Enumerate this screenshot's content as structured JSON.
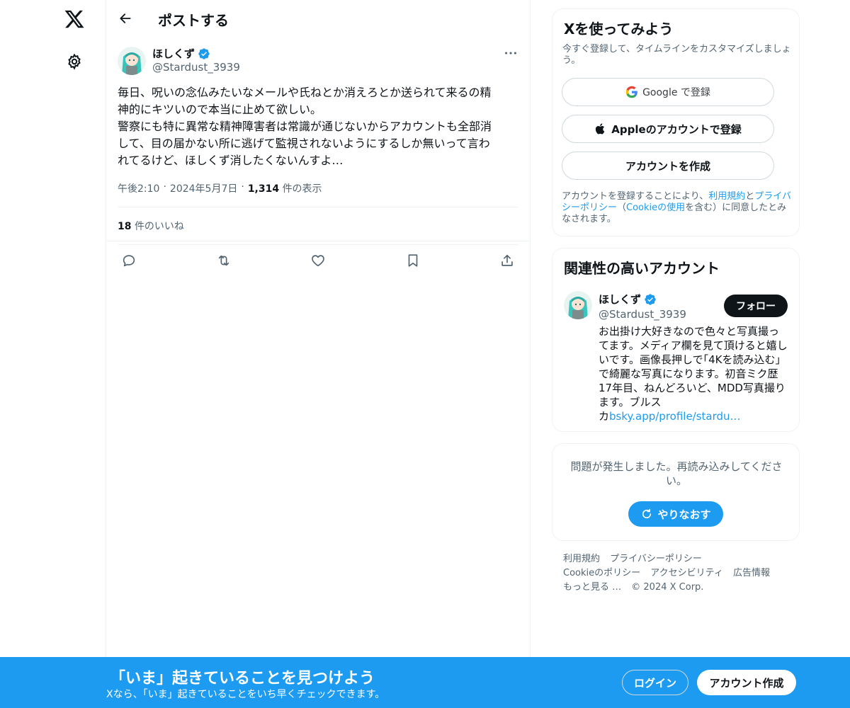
{
  "header": {
    "title": "ポストする"
  },
  "post": {
    "author_name": "ほしくず",
    "author_handle": "@Stardust_3939",
    "text": "毎日、呪いの念仏みたいなメールや氏ねとか消えろとか送られて来るの精\n神的にキツいので本当に止めて欲しい。\n警察にも特に異常な精神障害者は常識が通じないからアカウントも全部消\nして、目の届かない所に逃げて監視されないようにするしか無いって言わ\nれてるけど、ほしくず消したくないんすよ…",
    "time": "午後2:10",
    "date": "2024年5月7日",
    "views_count": "1,314",
    "views_label": "件の表示",
    "likes_count": "18",
    "likes_label": "件のいいね"
  },
  "signup": {
    "title": "Xを使ってみよう",
    "subtitle": "今すぐ登録して、タイムラインをカスタマイズしましょう。",
    "google_label": "Google で登録",
    "apple_label": "Appleのアカウントで登録",
    "create_label": "アカウントを作成",
    "terms_pre": "アカウントを登録することにより、",
    "terms_link": "利用規約",
    "terms_and": "と",
    "privacy_link": "プライバシーポリシー",
    "terms_mid": "（",
    "cookie_link": "Cookieの使用",
    "terms_post": "を含む）に同意したとみなされます。"
  },
  "related": {
    "title": "関連性の高いアカウント",
    "name": "ほしくず",
    "handle": "@Stardust_3939",
    "follow_label": "フォロー",
    "bio": "お出掛け大好きなので色々と写真撮っ\nてます。メディア欄を見て頂けると嬉し\nいです。画像長押しで｢4Kを読み込む｣\nで綺麗な写真になります。初音ミク歴\n17年目、ねんどろいど、MDD写真撮り\nます。ブルス\nカ",
    "bio_link": "bsky.app/profile/stardu…"
  },
  "error": {
    "message": "問題が発生しました。再読み込みしてください。",
    "retry_label": "やりなおす"
  },
  "footer": {
    "terms": "利用規約",
    "privacy": "プライバシーポリシー",
    "cookie": "Cookieのポリシー",
    "accessibility": "アクセシビリティ",
    "ads": "広告情報",
    "more": "もっと見る …",
    "copyright": "© 2024 X Corp."
  },
  "bottombar": {
    "title": "「いま」起きていることを見つけよう",
    "subtitle": "Xなら、「いま」起きていることをいち早くチェックできます。",
    "login_label": "ログイン",
    "signup_label": "アカウント作成"
  },
  "colors": {
    "accent": "#1d9bf0",
    "text": "#0f1419",
    "muted": "#536471",
    "border": "#eff3f4"
  }
}
